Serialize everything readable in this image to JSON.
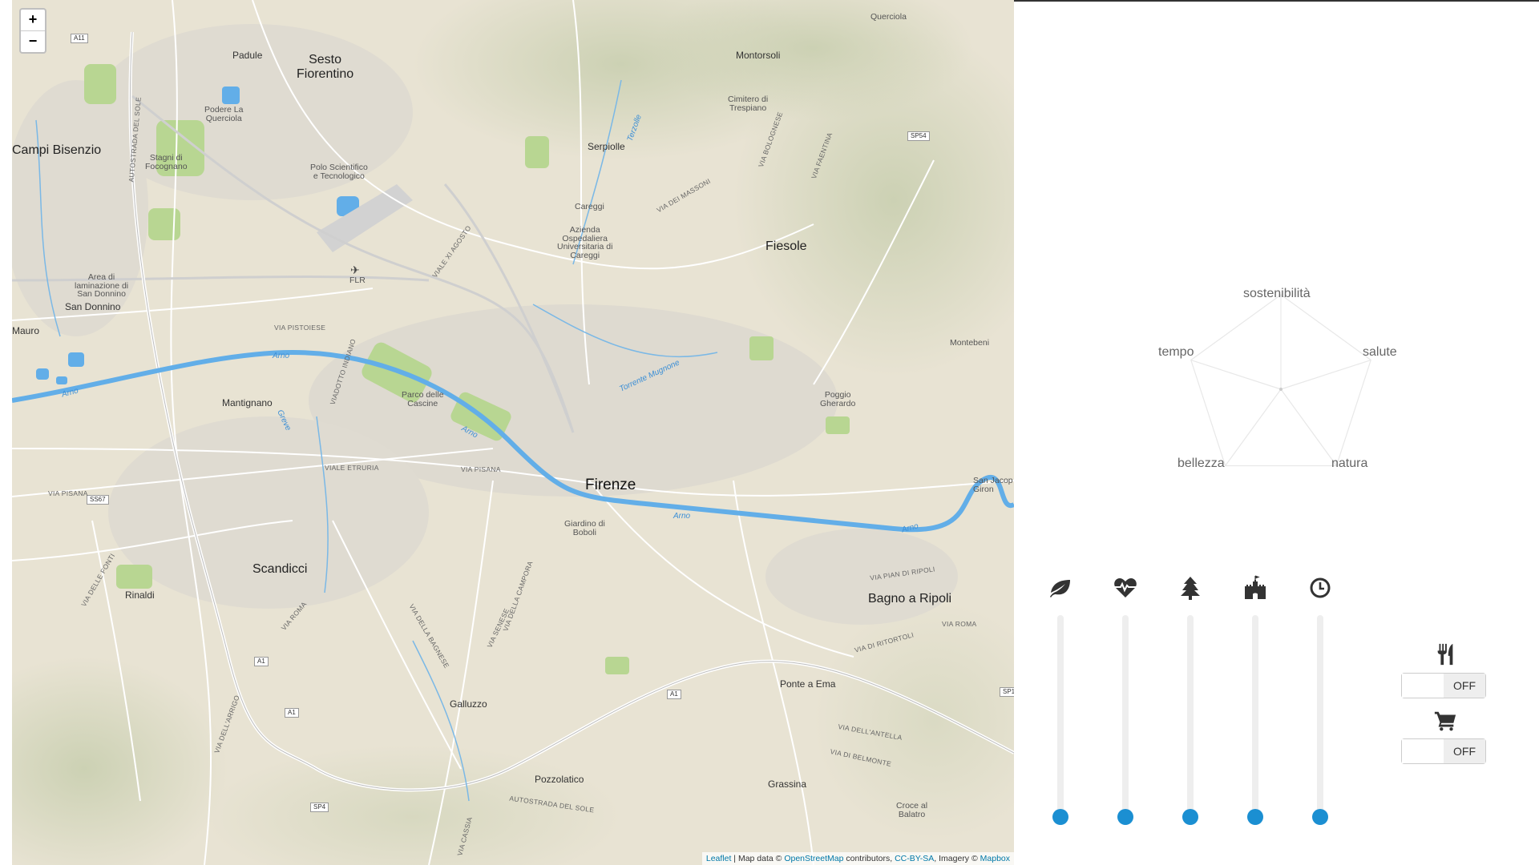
{
  "map": {
    "zoom_in": "+",
    "zoom_out": "−",
    "labels": {
      "sesto": "Sesto\nFiorentino",
      "campi": "Campi Bisenzio",
      "montorsoli": "Montorsoli",
      "querciola": "Querciola",
      "padule": "Padule",
      "podere": "Podere La\nQuerciola",
      "stagni": "Stagni di\nFocognano",
      "polo": "Polo Scientifico\ne Tecnologico",
      "serpiolle": "Serpiolle",
      "careggi": "Careggi",
      "azienda": "Azienda\nOspedaliera\nUniversitaria di\nCareggi",
      "cimitero": "Cimitero di\nTrespiano",
      "fiesole": "Fiesole",
      "flr": "FLR",
      "area": "Area di\nlaminazione di\nSan Donnino",
      "sandonnino": "San Donnino",
      "mauro": "Mauro",
      "montebeni": "Montebeni",
      "mantignano": "Mantignano",
      "parco": "Parco delle\nCascine",
      "poggio": "Poggio\nGherardo",
      "firenze": "Firenze",
      "sanjacopo": "San Jacop\nGiron",
      "giardino": "Giardino di\nBoboli",
      "scandicci": "Scandicci",
      "bagno": "Bagno a Ripoli",
      "rinaldi": "Rinaldi",
      "ponte": "Ponte a Ema",
      "galluzzo": "Galluzzo",
      "pozzolatico": "Pozzolatico",
      "grassina": "Grassina",
      "croce": "Croce al\nBalatro"
    },
    "roads": {
      "a11": "A11",
      "sp54": "SP54",
      "ss67": "SS67",
      "a1a": "A1",
      "a1b": "A1",
      "a1c": "A1",
      "sp4": "SP4",
      "sp1": "SP1",
      "viapistoiese": "VIA PISTOIESE",
      "viaprato": "VIALE ETRURIA",
      "viapisana1": "VIA PISANA",
      "viapisana2": "VIA PISANA",
      "viaxi": "VIALE XI AGOSTO",
      "viamassoni": "VIA DEI MASSONI",
      "viabolognese": "VIA BOLOGNESE",
      "viafaentina": "VIA FAENTINA",
      "autostrada1": "AUTOSTRADA DEL SOLE",
      "autostrada2": "AUTOSTRADA DEL SOLE",
      "viapianripoli": "VIA PIAN DI RIPOLI",
      "viaroma1": "VIA ROMA",
      "viaroma2": "VIA ROMA",
      "viaritortoli": "VIA DI RITORTOLI",
      "viaantella": "VIA DELL'ANTELLA",
      "viabelmonte": "VIA DI BELMONTE",
      "viasenese": "VIA SENESE",
      "viacassia": "VIA CASSIA",
      "viabagnese": "VIA DELLA BAGNESE",
      "viacampora": "VIA DELLA CAMPORA",
      "viafonti": "VIA DELLE FONTI",
      "viaarrigo": "VIA DELL'ARRIGO",
      "viadotto": "VIADOTTO INDIANO"
    },
    "water": {
      "arno1": "Arno",
      "arno2": "Arno",
      "arno3": "Arno",
      "arno4": "Arno",
      "arno5": "Arno",
      "mugnone": "Torrente Mugnone",
      "terzolle": "Terzolle",
      "greve": "Greve"
    },
    "attribution": {
      "leaflet": "Leaflet",
      "sep": " | Map data © ",
      "osm": "OpenStreetMap",
      "contrib": " contributors, ",
      "cc": "CC-BY-SA",
      "imagery": ", Imagery © ",
      "mapbox": "Mapbox"
    }
  },
  "radar": {
    "axes": [
      "sostenibilità",
      "salute",
      "natura",
      "bellezza",
      "tempo"
    ],
    "values": [
      0,
      0,
      0,
      0,
      0
    ]
  },
  "sliders": [
    {
      "icon": "leaf-icon",
      "value": 0
    },
    {
      "icon": "heartbeat-icon",
      "value": 0
    },
    {
      "icon": "tree-icon",
      "value": 0
    },
    {
      "icon": "castle-icon",
      "value": 0
    },
    {
      "icon": "clock-icon",
      "value": 0
    }
  ],
  "toggles": [
    {
      "icon": "cutlery-icon",
      "state": "OFF"
    },
    {
      "icon": "cart-icon",
      "state": "OFF"
    }
  ],
  "colors": {
    "slider_knob": "#1b8fd2",
    "river": "#62aee8",
    "map_bg": "#e9e4d6"
  }
}
